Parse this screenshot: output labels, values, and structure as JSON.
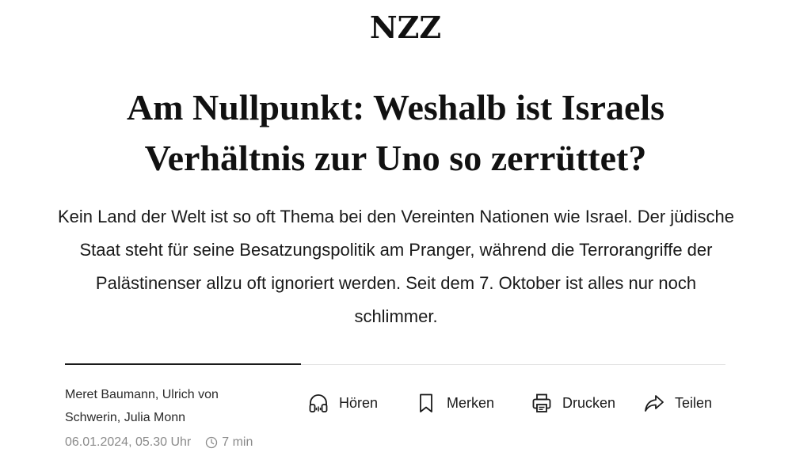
{
  "masthead": {
    "logo": "NZZ"
  },
  "article": {
    "headline": "Am Nullpunkt: Weshalb ist Israels Verhältnis zur Uno so zerrüttet?",
    "lead": "Kein Land der Welt ist so oft Thema bei den Vereinten Nationen wie Israel. Der jüdische Staat steht für seine Besatzungspolitik am Pranger, während die Terrorangriffe der Palästinenser allzu oft ignoriert werden. Seit dem 7. Oktober ist alles nur noch schlimmer.",
    "authors": "Meret Baumann, Ulrich von Schwerin, Julia Monn",
    "date": "06.01.2024, 05.30 Uhr",
    "read_time": "7 min"
  },
  "actions": {
    "listen": {
      "label": "Hören",
      "icon": "headphones-icon"
    },
    "bookmark": {
      "label": "Merken",
      "icon": "bookmark-icon"
    },
    "print": {
      "label": "Drucken",
      "icon": "printer-icon"
    },
    "share": {
      "label": "Teilen",
      "icon": "share-icon"
    }
  },
  "colors": {
    "text": "#121212",
    "meta": "#8a8a8a",
    "rule_dark": "#1a1a1a",
    "rule_light": "#e3e3e3"
  }
}
